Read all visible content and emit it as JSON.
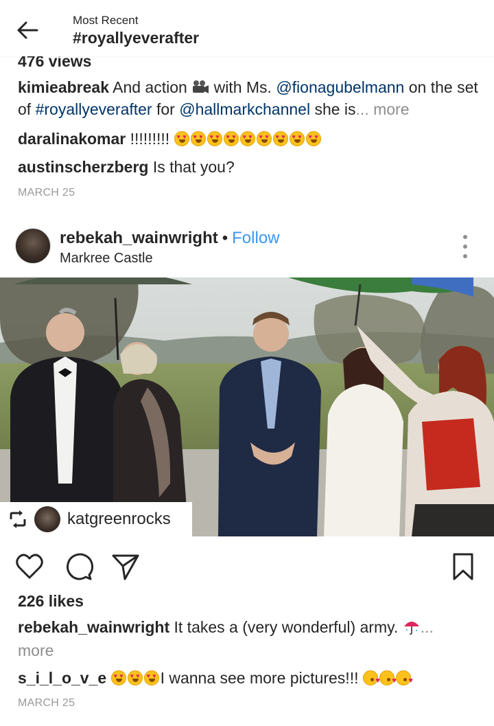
{
  "header": {
    "subtitle": "Most Recent",
    "title": "#royallyeverafter",
    "back_icon": "arrow-left-icon"
  },
  "post1": {
    "views": "476 views",
    "caption": {
      "username": "kimieabreak",
      "text_a": " And action ",
      "camera_icon": "movie-camera-icon",
      "text_b": " with Ms. ",
      "mention1": "@fionagubelmann",
      "text_c": " on the set of ",
      "hashtag": "#royallyeverafter",
      "text_d": " for ",
      "mention2": "@hallmarkchannel",
      "text_e": " she is",
      "ellipsis_more": "... more"
    },
    "comments": [
      {
        "username": "daralinakomar",
        "text": " !!!!!!!!! ",
        "emoji": "heart-eyes-emoji",
        "emoji_count": 9
      },
      {
        "username": "austinscherzberg",
        "text": " Is that you?"
      }
    ],
    "date": "MARCH 25"
  },
  "post2": {
    "username": "rebekah_wainwright",
    "separator": "•",
    "follow_label": "Follow",
    "location": "Markree Castle",
    "repost": {
      "icon": "repost-icon",
      "username": "katgreenrocks"
    },
    "actions": {
      "like_icon": "heart-icon",
      "comment_icon": "comment-icon",
      "share_icon": "send-icon",
      "save_icon": "bookmark-icon"
    },
    "likes": "226 likes",
    "caption": {
      "username": "rebekah_wainwright",
      "text": " It takes a (very wonderful) army. ",
      "emoji": "umbrella-emoji",
      "ellipsis": "...",
      "more": "more"
    },
    "comment": {
      "username": "s_i_l_o_v_e",
      "heart_eyes_count": 3,
      "text": "I wanna see more pictures!!! ",
      "kiss_count": 3
    },
    "date": "MARCH 25"
  },
  "colors": {
    "text": "#262626",
    "link": "#003569",
    "follow": "#3897f0",
    "muted": "#8e8e8e"
  }
}
